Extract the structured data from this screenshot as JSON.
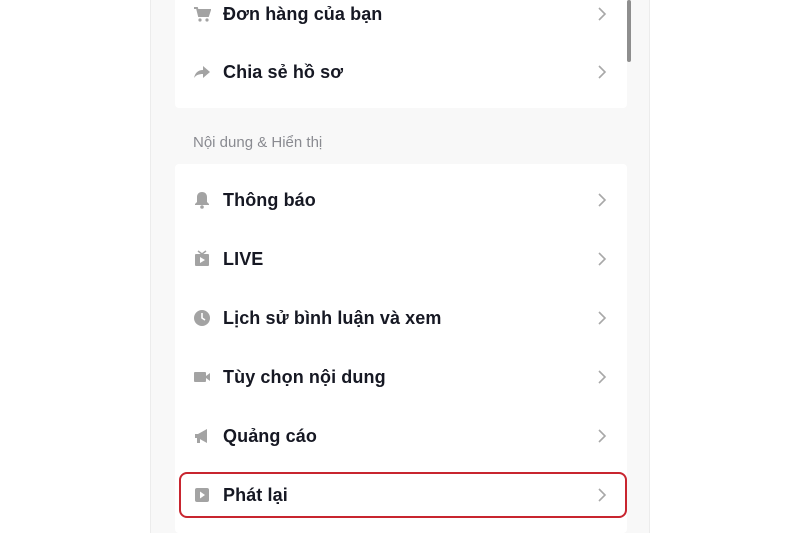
{
  "account_section": {
    "items": [
      {
        "label": "Đơn hàng của bạn",
        "icon": "cart-icon"
      },
      {
        "label": "Chia sẻ hồ sơ",
        "icon": "share-arrow-icon"
      }
    ]
  },
  "content_section": {
    "title": "Nội dung & Hiển thị",
    "items": [
      {
        "label": "Thông báo",
        "icon": "bell-icon"
      },
      {
        "label": "LIVE",
        "icon": "live-tv-icon"
      },
      {
        "label": "Lịch sử bình luận và xem",
        "icon": "clock-icon"
      },
      {
        "label": "Tùy chọn nội dung",
        "icon": "video-camera-icon"
      },
      {
        "label": "Quảng cáo",
        "icon": "megaphone-icon"
      },
      {
        "label": "Phát lại",
        "icon": "play-square-icon",
        "highlighted": true
      }
    ]
  },
  "colors": {
    "highlight": "#c8252f",
    "icon": "#a3a3a3",
    "text": "#161823",
    "section_title": "#8a8b91"
  }
}
